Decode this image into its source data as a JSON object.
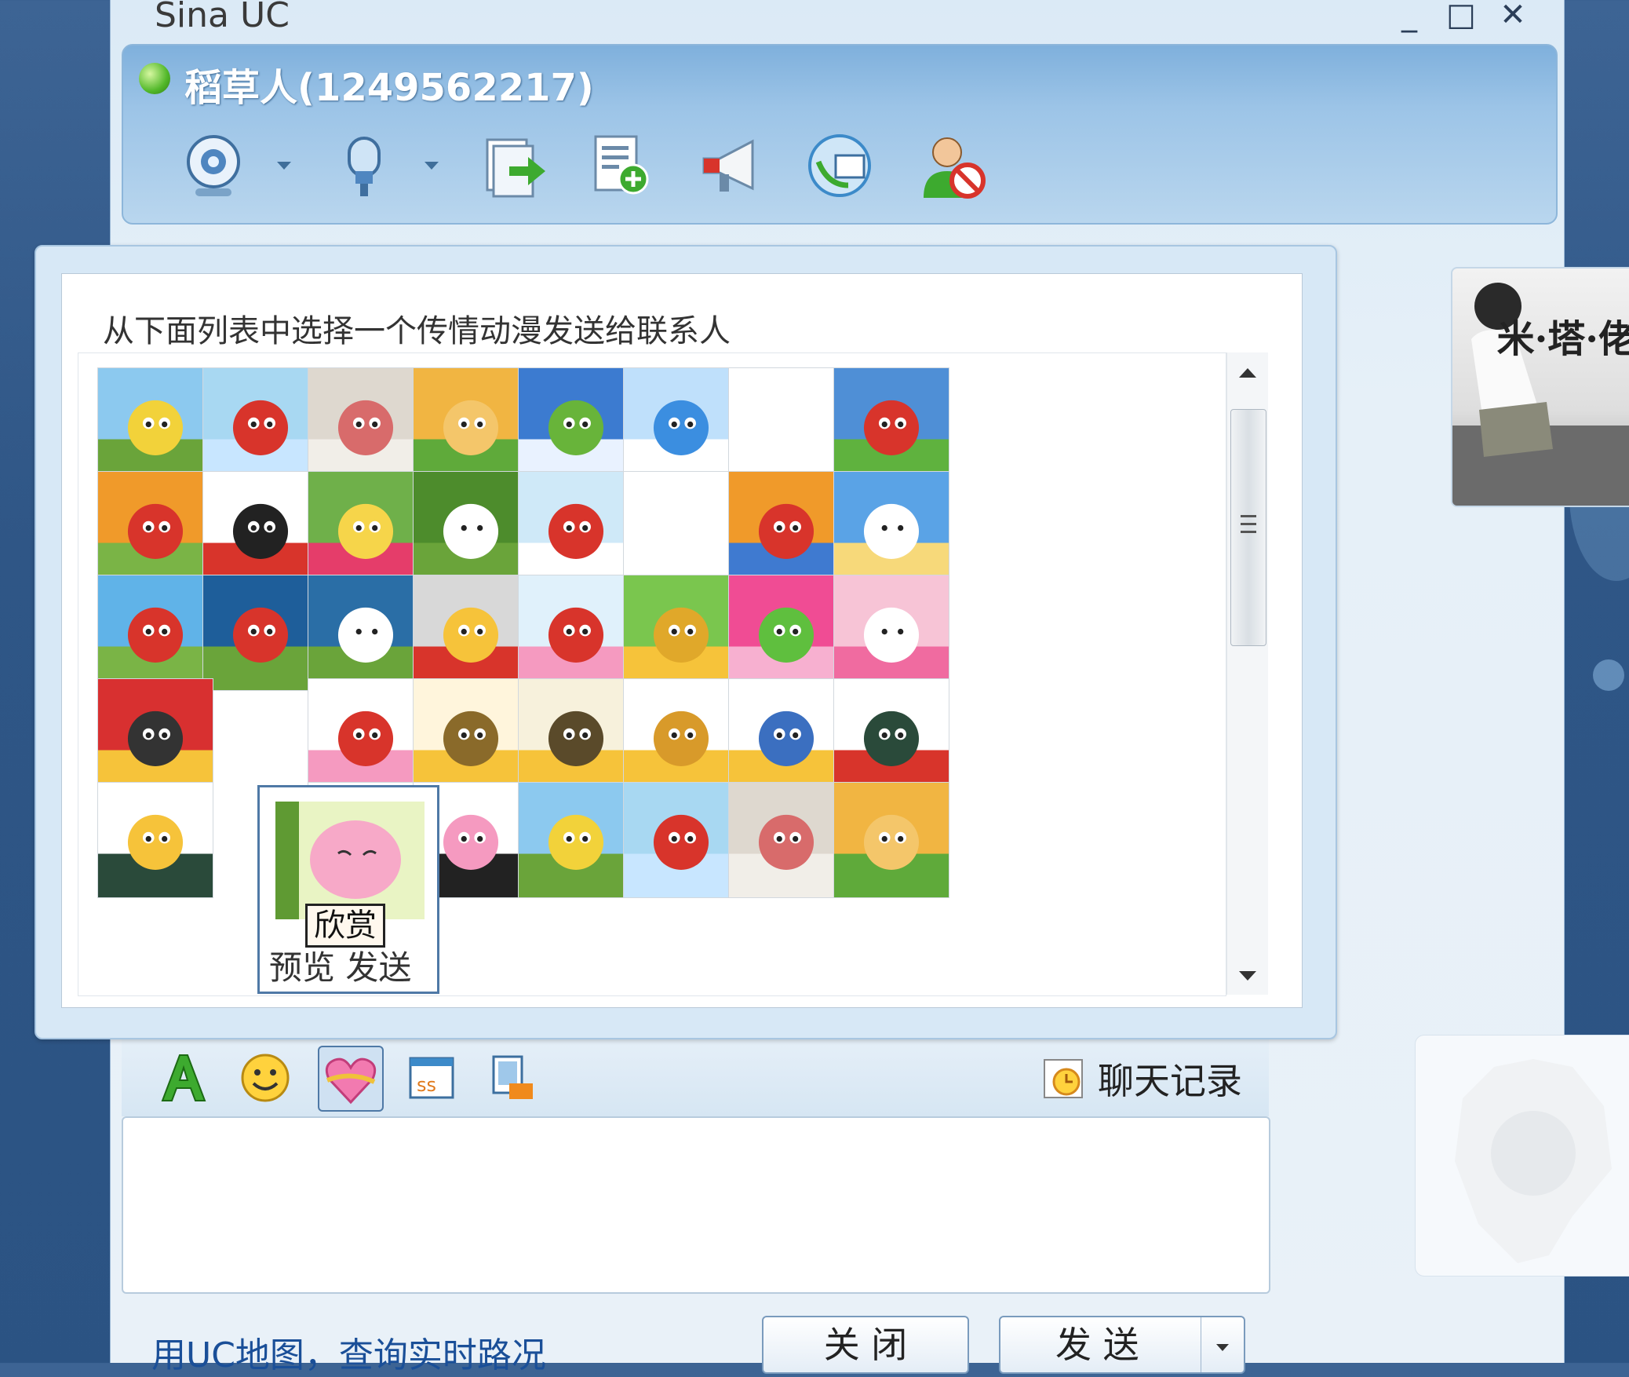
{
  "window": {
    "title": "Sina UC"
  },
  "header": {
    "contact_name": "稻草人(1249562217)",
    "status_color": "#52b82a",
    "toolbar_icons": [
      "webcam-icon",
      "microphone-icon",
      "send-file-icon",
      "add-note-icon",
      "broadcast-icon",
      "remote-assist-icon",
      "block-contact-icon"
    ]
  },
  "popup": {
    "instruction": "从下面列表中选择一个传情动漫发送给联系人",
    "preview": {
      "enjoy_label": "欣赏",
      "actions_label": "预览 发送"
    }
  },
  "photo": {
    "caption": "米·塔·佬"
  },
  "input_toolbar": {
    "tools": [
      "font-icon",
      "emoji-icon",
      "animation-icon",
      "scrawl-icon",
      "screenshot-icon"
    ],
    "history_label": "聊天记录"
  },
  "footer": {
    "link_text": "用UC地图，查询实时路况",
    "close_label": "关 闭",
    "send_label": "发 送"
  }
}
